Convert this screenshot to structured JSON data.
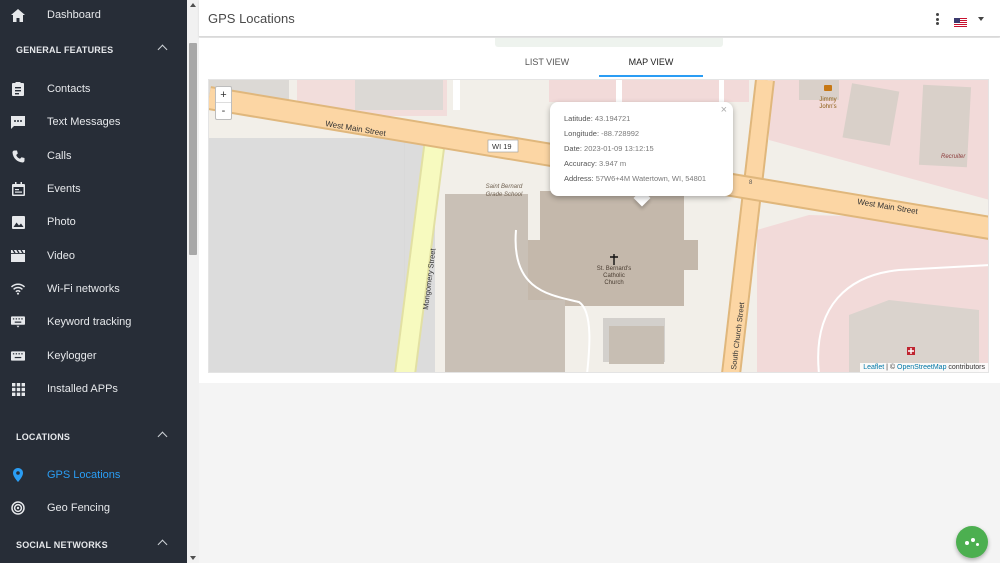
{
  "sidebar": {
    "top_item": {
      "label": "Dashboard",
      "icon": "home-icon"
    },
    "sections": {
      "general": "GENERAL FEATURES",
      "locations": "LOCATIONS",
      "social": "SOCIAL NETWORKS"
    },
    "general_items": [
      {
        "label": "Contacts",
        "icon": "contacts-icon"
      },
      {
        "label": "Text Messages",
        "icon": "sms-icon"
      },
      {
        "label": "Calls",
        "icon": "phone-icon"
      },
      {
        "label": "Events",
        "icon": "calendar-icon"
      },
      {
        "label": "Photo",
        "icon": "photo-icon"
      },
      {
        "label": "Video",
        "icon": "video-icon"
      },
      {
        "label": "Wi-Fi networks",
        "icon": "wifi-icon"
      },
      {
        "label": "Keyword tracking",
        "icon": "keyboard-icon"
      },
      {
        "label": "Keylogger",
        "icon": "keyboard-icon"
      },
      {
        "label": "Installed APPs",
        "icon": "apps-grid-icon"
      }
    ],
    "location_items": [
      {
        "label": "GPS Locations",
        "icon": "location-pin-icon",
        "active": true
      },
      {
        "label": "Geo Fencing",
        "icon": "target-icon"
      }
    ]
  },
  "header": {
    "title": "GPS Locations",
    "language": "US flag"
  },
  "tabs": [
    {
      "label": "LIST VIEW"
    },
    {
      "label": "MAP VIEW",
      "active": true
    }
  ],
  "map": {
    "zoom_in": "+",
    "zoom_out": "-",
    "labels": {
      "west_main_1": "West Main Street",
      "west_main_2": "West Main Street",
      "wi19": "WI 19",
      "montgomery": "Mongomery Street",
      "south_church": "South Church Street",
      "school": [
        "Saint Bernard",
        "Grade School"
      ],
      "church": [
        "St. Bernard's",
        "Catholic",
        "Church"
      ],
      "jimmy": [
        "Jimmy",
        "John's"
      ],
      "recruiter": "Recruiter",
      "house_no": "8"
    },
    "attribution": {
      "leaflet": "Leaflet",
      "sep": " | © ",
      "osm": "OpenStreetMap",
      "suffix": " contributors"
    },
    "popup": {
      "close": "×",
      "rows": [
        {
          "label": "Latitude:",
          "value": "43.194721"
        },
        {
          "label": "Longitude:",
          "value": "-88.728992"
        },
        {
          "label": "Date:",
          "value": "2023-01-09 13:12:15"
        },
        {
          "label": "Accuracy:",
          "value": "3.947 m"
        },
        {
          "label": "Address:",
          "value": "57W6+4M Watertown, WI, 54801"
        }
      ]
    }
  },
  "colors": {
    "sidebar_bg": "#272d37",
    "accent": "#2a9df4",
    "fab": "#4caf50"
  }
}
